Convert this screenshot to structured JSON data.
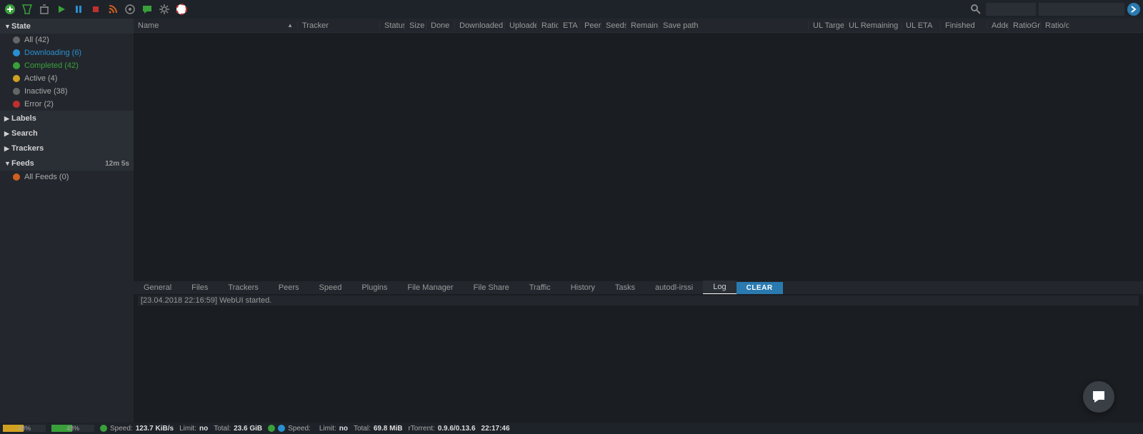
{
  "toolbar": {
    "search_placeholder": ""
  },
  "sidebar": {
    "sections": {
      "state": {
        "label": "State",
        "items": [
          {
            "label": "All (42)",
            "cls": "",
            "dot": "dot-gray"
          },
          {
            "label": "Downloading (6)",
            "cls": "downloading",
            "dot": "dot-blue"
          },
          {
            "label": "Completed (42)",
            "cls": "completed",
            "dot": "dot-green"
          },
          {
            "label": "Active (4)",
            "cls": "",
            "dot": "dot-yellow"
          },
          {
            "label": "Inactive (38)",
            "cls": "",
            "dot": "dot-gray"
          },
          {
            "label": "Error (2)",
            "cls": "",
            "dot": "dot-red"
          }
        ]
      },
      "labels": {
        "label": "Labels"
      },
      "search": {
        "label": "Search"
      },
      "trackers": {
        "label": "Trackers"
      },
      "feeds": {
        "label": "Feeds",
        "timer": "12m 5s",
        "items": [
          {
            "label": "All Feeds (0)",
            "dot": "dot-orange"
          }
        ]
      }
    }
  },
  "columns": {
    "name": "Name",
    "tracker": "Tracker",
    "status": "Status",
    "size": "Size",
    "done": "Done",
    "downloaded": "Downloaded",
    "uploaded": "Uploaded",
    "ratio": "Ratio",
    "eta": "ETA",
    "peers": "Peers",
    "seeds": "Seeds",
    "remaining": "Remaining",
    "savepath": "Save path",
    "ultarget": "UL Target",
    "ulremaining": "UL Remaining",
    "uleta": "UL ETA",
    "finished": "Finished",
    "added": "Added",
    "ratiogroup": "RatioGroup",
    "ratioda": "Ratio/da"
  },
  "tabs": {
    "general": "General",
    "files": "Files",
    "trackers": "Trackers",
    "peers": "Peers",
    "speed": "Speed",
    "plugins": "Plugins",
    "filemanager": "File Manager",
    "fileshare": "File Share",
    "traffic": "Traffic",
    "history": "History",
    "tasks": "Tasks",
    "autodl": "autodl-irssi",
    "log": "Log",
    "clear": "CLEAR"
  },
  "log": {
    "line1": "[23.04.2018 22:16:59] WebUI started."
  },
  "status": {
    "disk1_pct": "48%",
    "disk2_pct": "48%",
    "speed_label": "Speed:",
    "dl_speed": "123.7 KiB/s",
    "limit_label": "Limit:",
    "dl_limit": "no",
    "total_label": "Total:",
    "dl_total": "23.6 GiB",
    "ul_speed": "",
    "ul_limit": "no",
    "ul_total": "69.8 MiB",
    "rtorrent_label": "rTorrent:",
    "rtorrent_ver": "0.9.6/0.13.6",
    "time": "22:17:46"
  }
}
